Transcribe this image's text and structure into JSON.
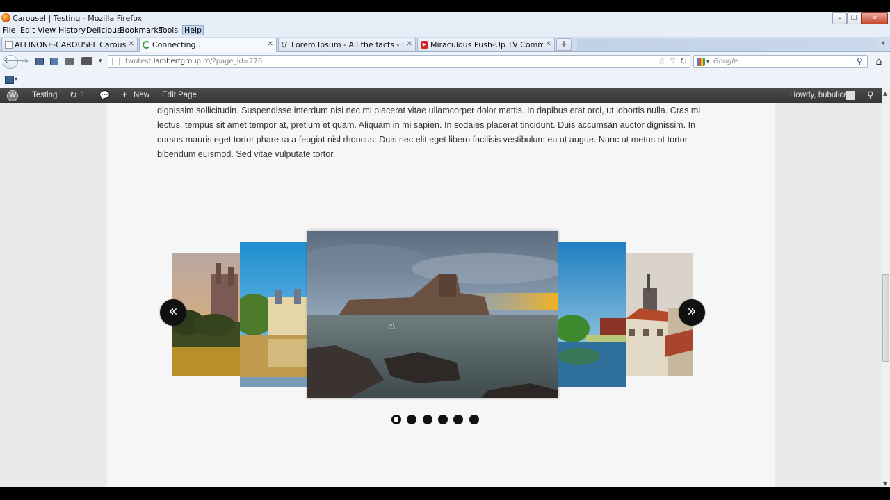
{
  "window": {
    "title": "Carousel | Testing - Mozilla Firefox",
    "controls": [
      "minimize",
      "restore",
      "close"
    ]
  },
  "menubar": {
    "items": [
      "File",
      "Edit",
      "View",
      "History",
      "Delicious",
      "Bookmarks",
      "Tools",
      "Help"
    ]
  },
  "tabs": [
    {
      "label": "ALLINONE-CAROUSEL Carousel Setti...",
      "icon": "page-icon",
      "active": false
    },
    {
      "label": "Connecting...",
      "icon": "loading-icon",
      "active": true
    },
    {
      "label": "Lorem Ipsum - All the facts - Lipsum ...",
      "icon": "lipsum-icon",
      "active": false
    },
    {
      "label": "Miraculous Push-Up TV Commercial ...",
      "icon": "youtube-icon",
      "active": false
    }
  ],
  "new_tab_label": "+",
  "navbar": {
    "url_prefix": "twotest.",
    "url_domain": "lambertgroup.ro",
    "url_suffix": "/?page_id=276",
    "search_placeholder": "Google"
  },
  "admin_bar": {
    "site_name": "Testing",
    "updates_count": "1",
    "new_label": "New",
    "edit_label": "Edit Page",
    "howdy": "Howdy, bubulica"
  },
  "content": {
    "paragraph_lines": [
      "dignissim sollicitudin. Suspendisse interdum nisi nec mi placerat vitae ullamcorper dolor mattis. In dapibus erat orci, ut lobortis nulla. Cras mi",
      "lectus, tempus sit amet tempor at, pretium et quam. Aliquam in mi sapien. In sodales placerat tincidunt. Duis accumsan auctor dignissim. In",
      "cursus mauris eget tortor pharetra a feugiat nisl rhoncus. Duis nec elit eget libero facilisis vestibulum eu ut augue. Nunc ut metus at tortor",
      "bibendum euismod. Sed vitae vulputate tortor."
    ]
  },
  "carousel": {
    "prev_arrow": "«",
    "next_arrow": "»",
    "slides": [
      "castle-field",
      "chateau-lake",
      "sea-fortress",
      "river-village",
      "old-town"
    ],
    "current_index": 0,
    "dots_count": 6
  },
  "colors": {
    "admin_bar": "#464646",
    "page_bg": "#f6f6f6",
    "accent_dark": "#111111"
  }
}
